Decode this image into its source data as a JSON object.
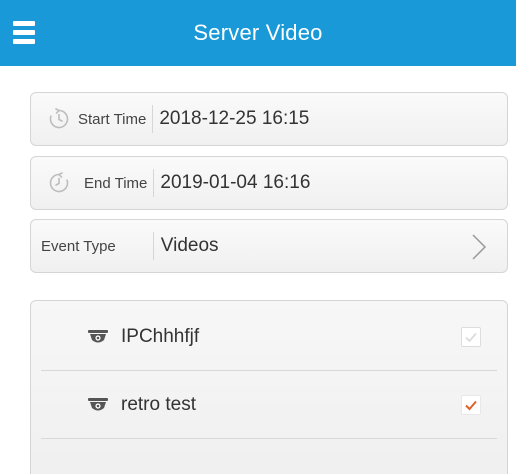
{
  "header": {
    "title": "Server Video",
    "menu_icon": "hamburger-menu-icon",
    "background_color": "#1a99d8"
  },
  "search_form": {
    "start_time": {
      "label": "Start Time",
      "value": "2018-12-25 16:15",
      "icon": "clock-forward-icon"
    },
    "end_time": {
      "label": "End Time",
      "value": "2019-01-04 16:16",
      "icon": "clock-backward-icon"
    },
    "event_type": {
      "label": "Event Type",
      "value": "Videos",
      "icon": "chevron-right-icon"
    }
  },
  "devices": [
    {
      "name": "IPChhhfjf",
      "icon": "camera-icon",
      "checked": false,
      "checkbox_state": "disabled"
    },
    {
      "name": "retro test",
      "icon": "camera-icon",
      "checked": true,
      "checkbox_state": "checked",
      "check_color": "#e0602a"
    }
  ]
}
